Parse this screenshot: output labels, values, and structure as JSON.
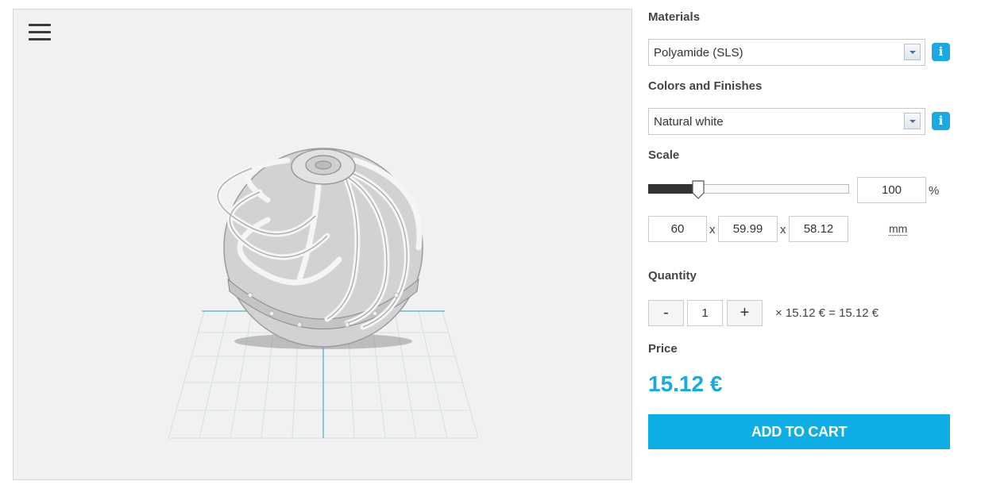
{
  "viewer": {
    "menu_icon": "hamburger-menu-icon"
  },
  "materials": {
    "label": "Materials",
    "selected": "Polyamide (SLS)",
    "info_icon": "i"
  },
  "finishes": {
    "label": "Colors and Finishes",
    "selected": "Natural white",
    "info_icon": "i"
  },
  "scale": {
    "label": "Scale",
    "value": "100",
    "percent_sign": "%",
    "slider_level": 0.25,
    "dims": {
      "x": "60",
      "y": "59.99",
      "z": "58.12",
      "separator": "x"
    },
    "unit": "mm"
  },
  "quantity": {
    "label": "Quantity",
    "minus": "-",
    "value": "1",
    "plus": "+",
    "summary": "× 15.12 € = 15.12 €"
  },
  "price": {
    "label": "Price",
    "value": "15.12 €"
  },
  "cart": {
    "label": "ADD TO CART"
  },
  "colors": {
    "accent": "#1aa9e0",
    "cart": "#0fade6",
    "viewer_bg": "#f1f1f1"
  }
}
